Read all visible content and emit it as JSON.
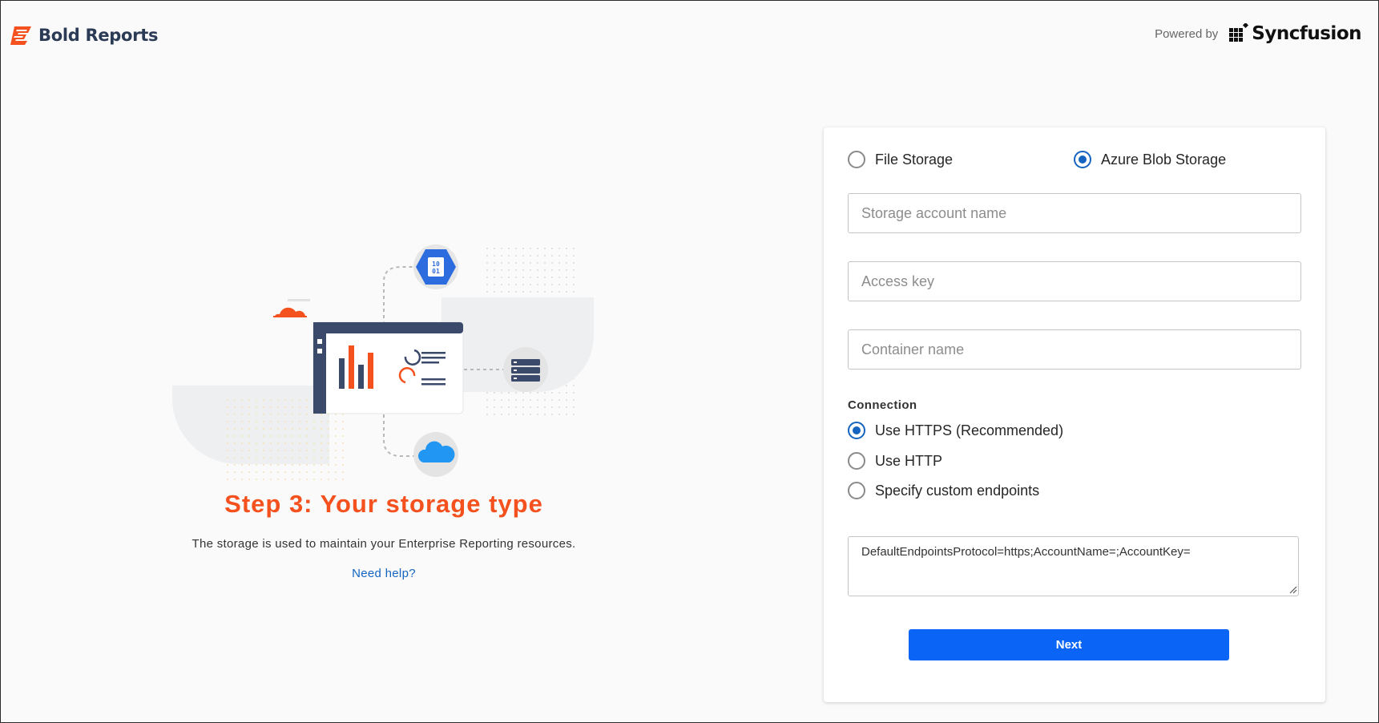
{
  "header": {
    "brand_name": "Bold Reports",
    "powered_by_label": "Powered by",
    "partner_name": "Syncfusion"
  },
  "intro": {
    "step_title": "Step 3: Your storage type",
    "description": "The storage is used to maintain your Enterprise Reporting resources.",
    "help_link": "Need help?",
    "icon_binary_text": [
      "10",
      "01"
    ]
  },
  "form": {
    "storage_options": [
      {
        "label": "File Storage",
        "selected": false
      },
      {
        "label": "Azure Blob Storage",
        "selected": true
      }
    ],
    "storage_account_placeholder": "Storage account name",
    "access_key_placeholder": "Access key",
    "container_placeholder": "Container name",
    "connection_label": "Connection",
    "connection_options": [
      {
        "label": "Use HTTPS (Recommended)",
        "selected": true
      },
      {
        "label": "Use HTTP",
        "selected": false
      },
      {
        "label": "Specify custom endpoints",
        "selected": false
      }
    ],
    "connection_string": "DefaultEndpointsProtocol=https;AccountName=;AccountKey=",
    "next_label": "Next"
  },
  "colors": {
    "accent": "#f4511e",
    "primary": "#0a64f5",
    "radio_selected": "#1565c0",
    "brand_text": "#2b3a55"
  }
}
